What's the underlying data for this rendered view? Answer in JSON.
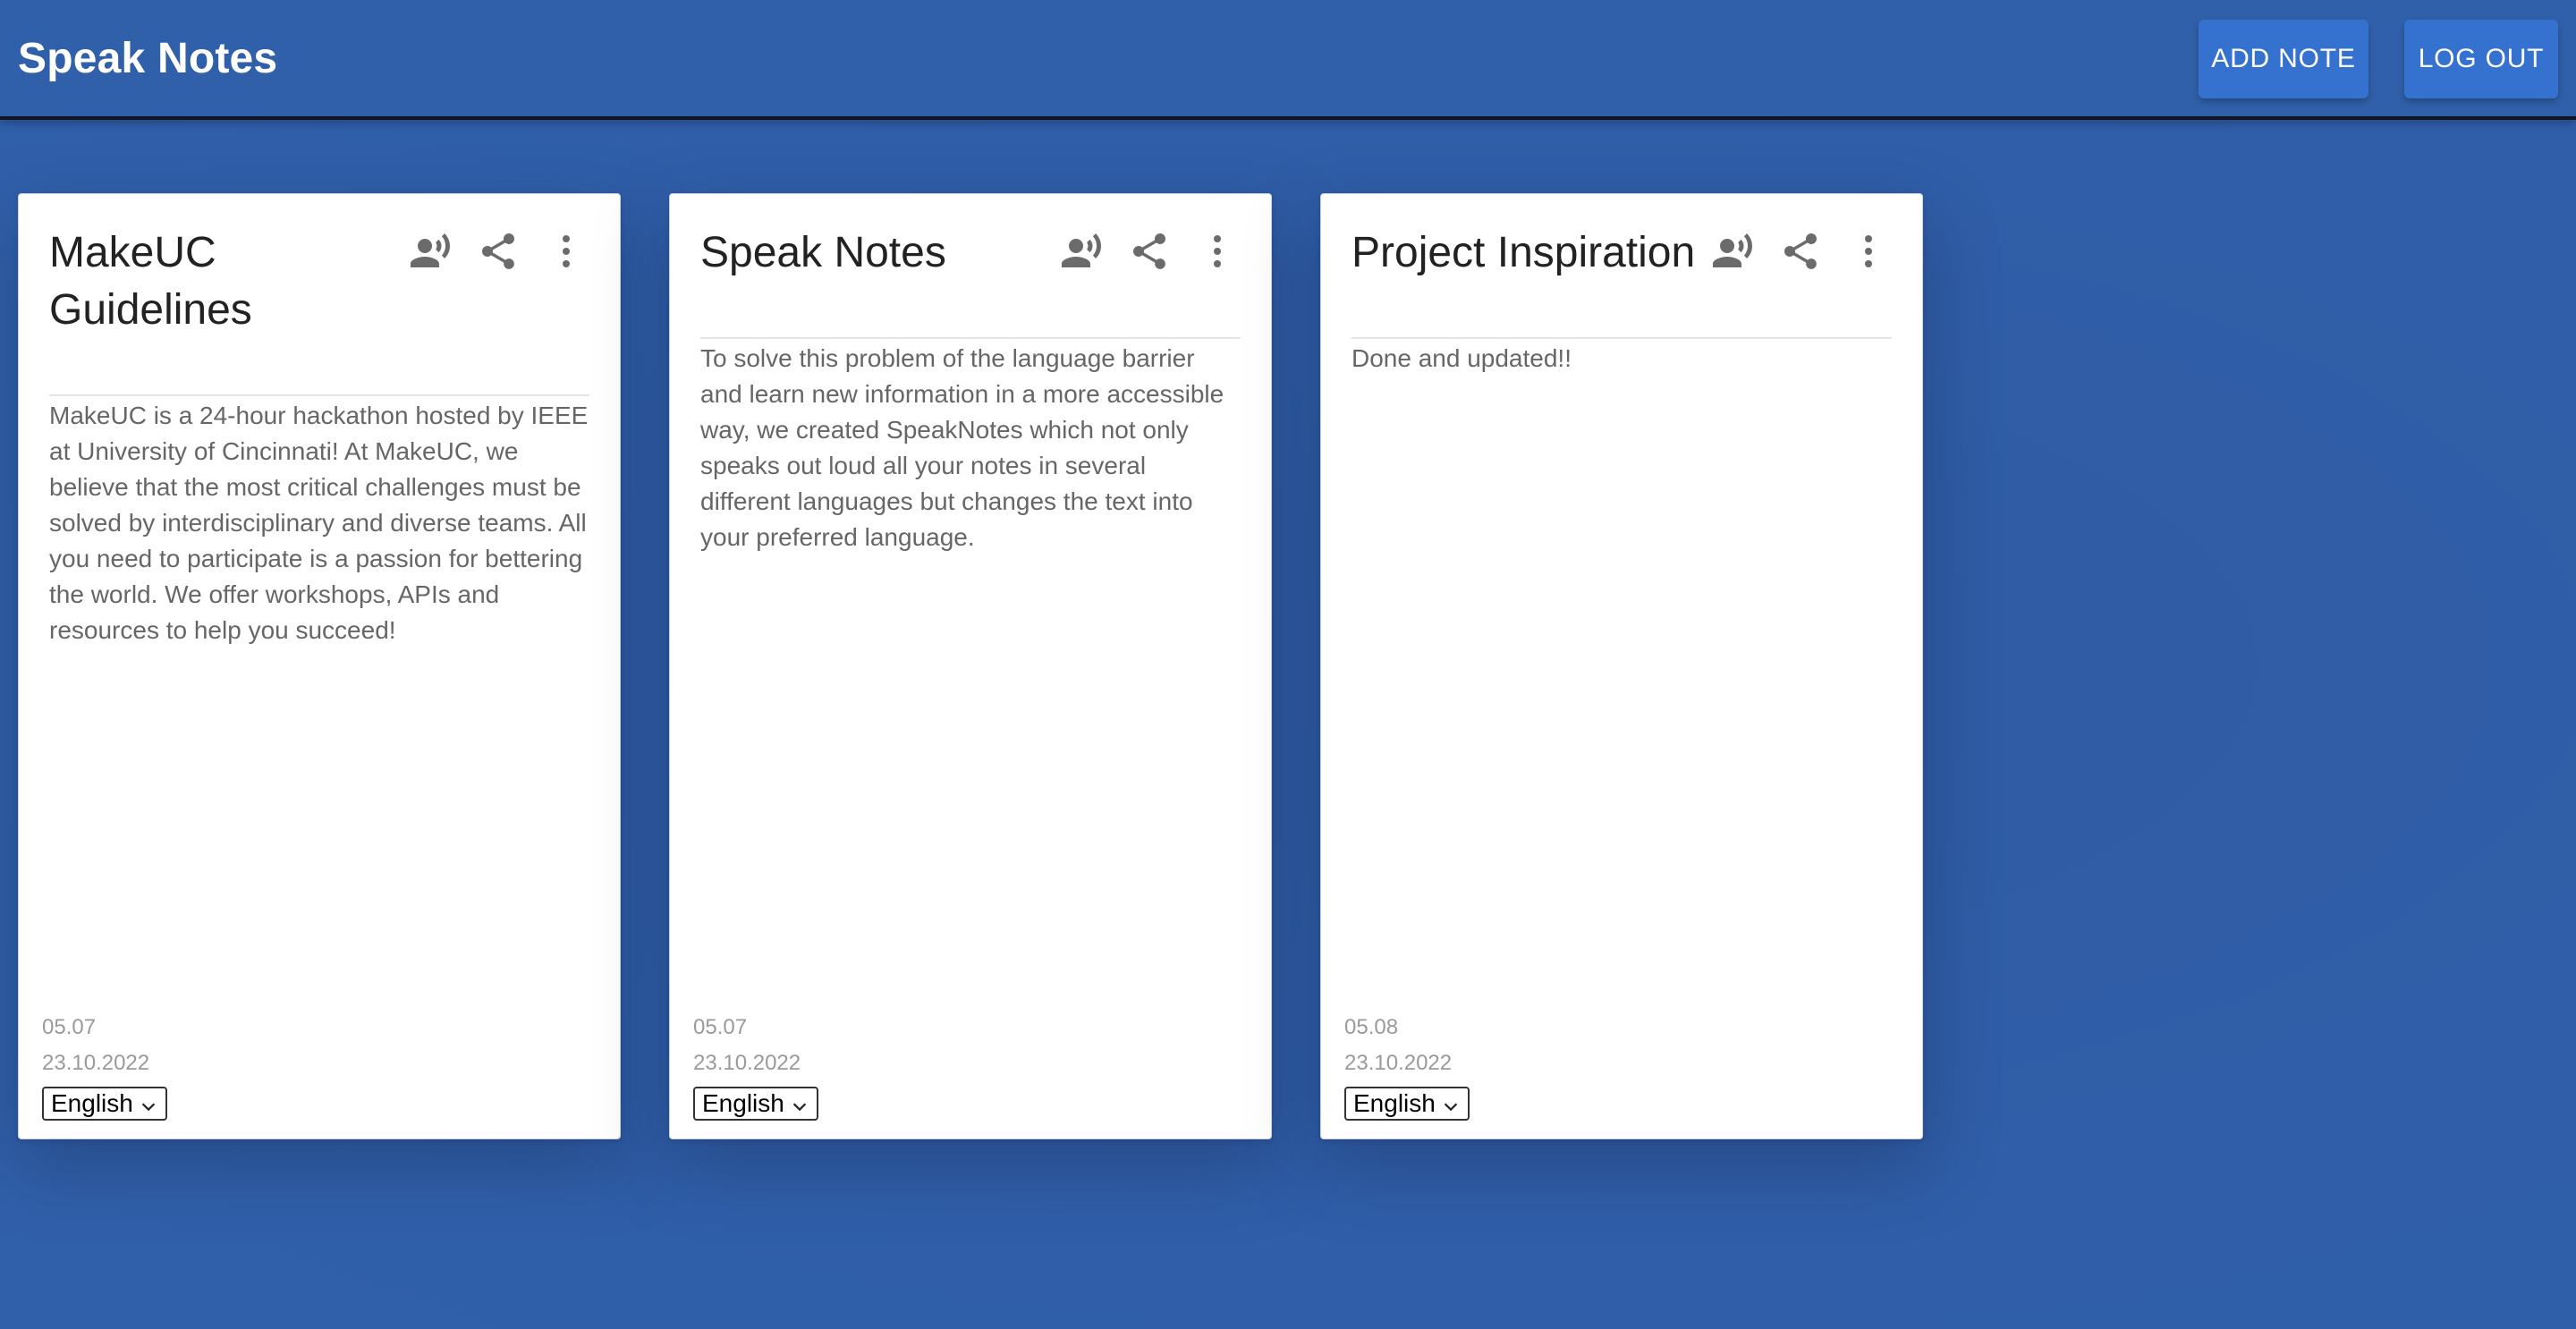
{
  "app": {
    "title": "Speak Notes",
    "add_note_label": "ADD NOTE",
    "log_out_label": "LOG OUT"
  },
  "colors": {
    "background": "#2f5da6",
    "appbar": "#3160aa",
    "button": "#3572d0",
    "card": "#ffffff",
    "icon": "#6b6b6b"
  },
  "icons": [
    "record-voice-icon",
    "share-icon",
    "more-vert-icon",
    "chevron-down-icon"
  ],
  "notes": [
    {
      "title": "MakeUC Guidelines",
      "body": "MakeUC is a 24-hour hackathon hosted by IEEE at University of Cincinnati! At MakeUC, we believe that the most critical challenges must be solved by interdisciplinary and diverse teams. All you need to participate is a passion for bettering the world. We offer workshops, APIs and resources to help you succeed!",
      "time": "05.07",
      "date": "23.10.2022",
      "language": "English"
    },
    {
      "title": "Speak Notes",
      "body": "To solve this problem of the language barrier and learn new information in a more accessible way, we created SpeakNotes which not only speaks out loud all your notes in several different languages but changes the text into your preferred language.",
      "time": "05.07",
      "date": "23.10.2022",
      "language": "English"
    },
    {
      "title": "Project Inspiration",
      "body": "Done and updated!!",
      "time": "05.08",
      "date": "23.10.2022",
      "language": "English"
    }
  ]
}
